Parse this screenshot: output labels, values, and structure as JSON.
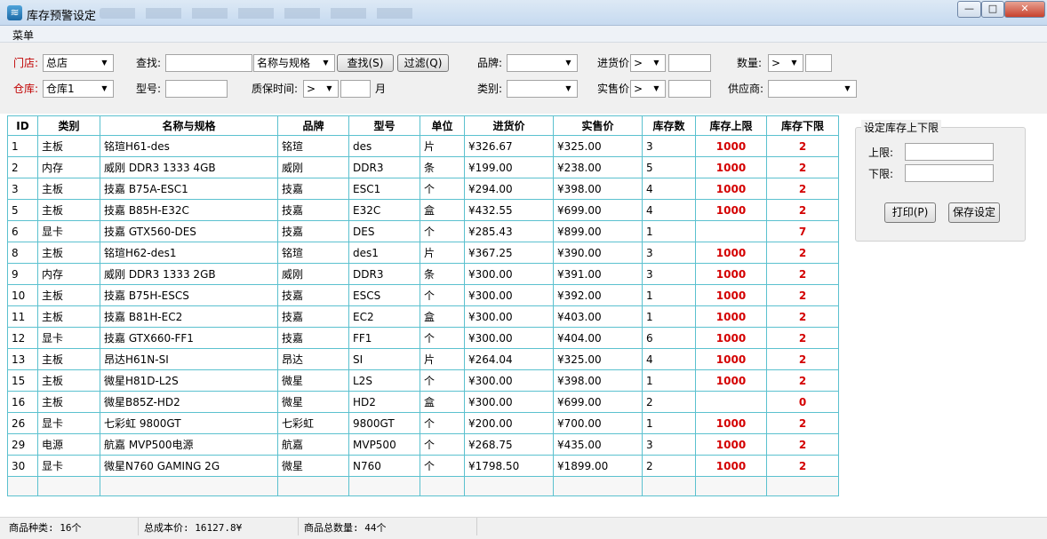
{
  "window": {
    "title": "库存预警设定",
    "minimize_label": "—",
    "maximize_label": "□",
    "close_label": "✕"
  },
  "menu": {
    "label": "菜单"
  },
  "filters": {
    "store_label": "门店:",
    "store_value": "总店",
    "warehouse_label": "仓库:",
    "warehouse_value": "仓库1",
    "search_label": "查找:",
    "search_value": "",
    "search_field_value": "名称与规格",
    "search_button": "查找(S)",
    "filter_button": "过滤(Q)",
    "model_label": "型号:",
    "model_value": "",
    "warranty_label": "质保时间:",
    "warranty_op": ">",
    "warranty_value": "",
    "warranty_unit": "月",
    "brand_label": "品牌:",
    "brand_value": "",
    "category_label": "类别:",
    "category_value": "",
    "purchase_label": "进货价",
    "purchase_op": ">",
    "purchase_value": "",
    "sale_label": "实售价",
    "sale_op": ">",
    "sale_value": "",
    "quantity_label": "数量:",
    "quantity_op": ">",
    "quantity_value": "",
    "supplier_label": "供应商:",
    "supplier_value": ""
  },
  "grid": {
    "columns": [
      "ID",
      "类别",
      "名称与规格",
      "品牌",
      "型号",
      "单位",
      "进货价",
      "实售价",
      "库存数",
      "库存上限",
      "库存下限"
    ],
    "rows": [
      [
        "1",
        "主板",
        "铭瑄H61-des",
        "铭瑄",
        "des",
        "片",
        "¥326.67",
        "¥325.00",
        "3",
        "1000",
        "2"
      ],
      [
        "2",
        "内存",
        "威刚 DDR3 1333 4GB",
        "威刚",
        "DDR3",
        "条",
        "¥199.00",
        "¥238.00",
        "5",
        "1000",
        "2"
      ],
      [
        "3",
        "主板",
        "技嘉 B75A-ESC1",
        "技嘉",
        "ESC1",
        "个",
        "¥294.00",
        "¥398.00",
        "4",
        "1000",
        "2"
      ],
      [
        "5",
        "主板",
        "技嘉 B85H-E32C",
        "技嘉",
        "E32C",
        "盒",
        "¥432.55",
        "¥699.00",
        "4",
        "1000",
        "2"
      ],
      [
        "6",
        "显卡",
        "技嘉 GTX560-DES",
        "技嘉",
        "DES",
        "个",
        "¥285.43",
        "¥899.00",
        "1",
        "",
        "7"
      ],
      [
        "8",
        "主板",
        "铭瑄H62-des1",
        "铭瑄",
        "des1",
        "片",
        "¥367.25",
        "¥390.00",
        "3",
        "1000",
        "2"
      ],
      [
        "9",
        "内存",
        "威刚 DDR3 1333 2GB",
        "威刚",
        "DDR3",
        "条",
        "¥300.00",
        "¥391.00",
        "3",
        "1000",
        "2"
      ],
      [
        "10",
        "主板",
        "技嘉 B75H-ESCS",
        "技嘉",
        "ESCS",
        "个",
        "¥300.00",
        "¥392.00",
        "1",
        "1000",
        "2"
      ],
      [
        "11",
        "主板",
        "技嘉 B81H-EC2",
        "技嘉",
        "EC2",
        "盒",
        "¥300.00",
        "¥403.00",
        "1",
        "1000",
        "2"
      ],
      [
        "12",
        "显卡",
        "技嘉 GTX660-FF1",
        "技嘉",
        "FF1",
        "个",
        "¥300.00",
        "¥404.00",
        "6",
        "1000",
        "2"
      ],
      [
        "13",
        "主板",
        "昂达H61N-SI",
        "昂达",
        "SI",
        "片",
        "¥264.04",
        "¥325.00",
        "4",
        "1000",
        "2"
      ],
      [
        "15",
        "主板",
        "微星H81D-L2S",
        "微星",
        "L2S",
        "个",
        "¥300.00",
        "¥398.00",
        "1",
        "1000",
        "2"
      ],
      [
        "16",
        "主板",
        "微星B85Z-HD2",
        "微星",
        "HD2",
        "盒",
        "¥300.00",
        "¥699.00",
        "2",
        "",
        "0"
      ],
      [
        "26",
        "显卡",
        "七彩虹 9800GT",
        "七彩虹",
        "9800GT",
        "个",
        "¥200.00",
        "¥700.00",
        "1",
        "1000",
        "2"
      ],
      [
        "29",
        "电源",
        "航嘉 MVP500电源",
        "航嘉",
        "MVP500",
        "个",
        "¥268.75",
        "¥435.00",
        "3",
        "1000",
        "2"
      ],
      [
        "30",
        "显卡",
        "微星N760 GAMING 2G",
        "微星",
        "N760",
        "个",
        "¥1798.50",
        "¥1899.00",
        "2",
        "1000",
        "2"
      ]
    ]
  },
  "limits_panel": {
    "title": "设定库存上下限",
    "upper_label": "上限:",
    "upper_value": "",
    "lower_label": "下限:",
    "lower_value": "",
    "print_button": "打印(P)",
    "save_button": "保存设定"
  },
  "status": {
    "kinds": "商品种类: 16个",
    "total_cost": "总成本价: 16127.8¥",
    "total_qty": "商品总数量: 44个"
  }
}
